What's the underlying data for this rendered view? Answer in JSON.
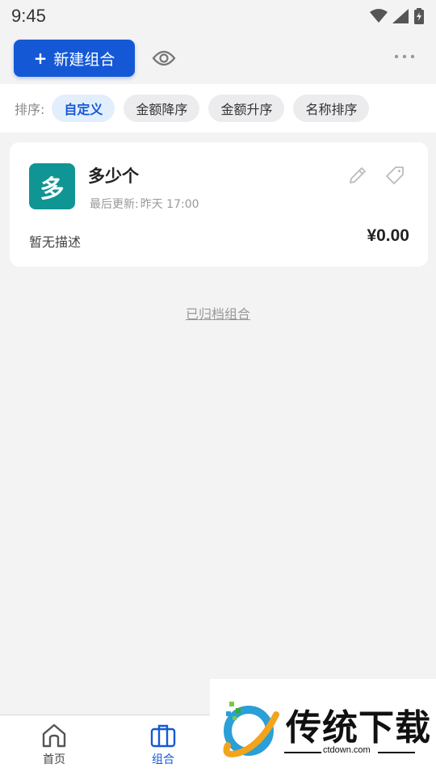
{
  "status_bar": {
    "time": "9:45"
  },
  "toolbar": {
    "new_label": "新建组合",
    "icons": [
      "plus-icon",
      "eye-icon",
      "more-dots-icon"
    ]
  },
  "sort": {
    "label": "排序:",
    "options": [
      {
        "label": "自定义",
        "active": true
      },
      {
        "label": "金额降序",
        "active": false
      },
      {
        "label": "金额升序",
        "active": false
      },
      {
        "label": "名称排序",
        "active": false
      }
    ]
  },
  "card": {
    "avatar_char": "多",
    "avatar_color": "#0f9594",
    "title": "多少个",
    "updated_label": "最后更新:",
    "updated_value": "昨天 17:00",
    "description": "暂无描述",
    "amount": "¥0.00"
  },
  "archived_link": "已归档组合",
  "bottom_nav": [
    {
      "label": "首页",
      "icon": "home-icon",
      "active": false
    },
    {
      "label": "组合",
      "icon": "briefcase-icon",
      "active": true
    }
  ],
  "watermark": {
    "brand": "传统下载",
    "url": "ctdown.com"
  },
  "colors": {
    "accent": "#1558d6",
    "background": "#f3f3f4",
    "avatar": "#0f9594"
  }
}
